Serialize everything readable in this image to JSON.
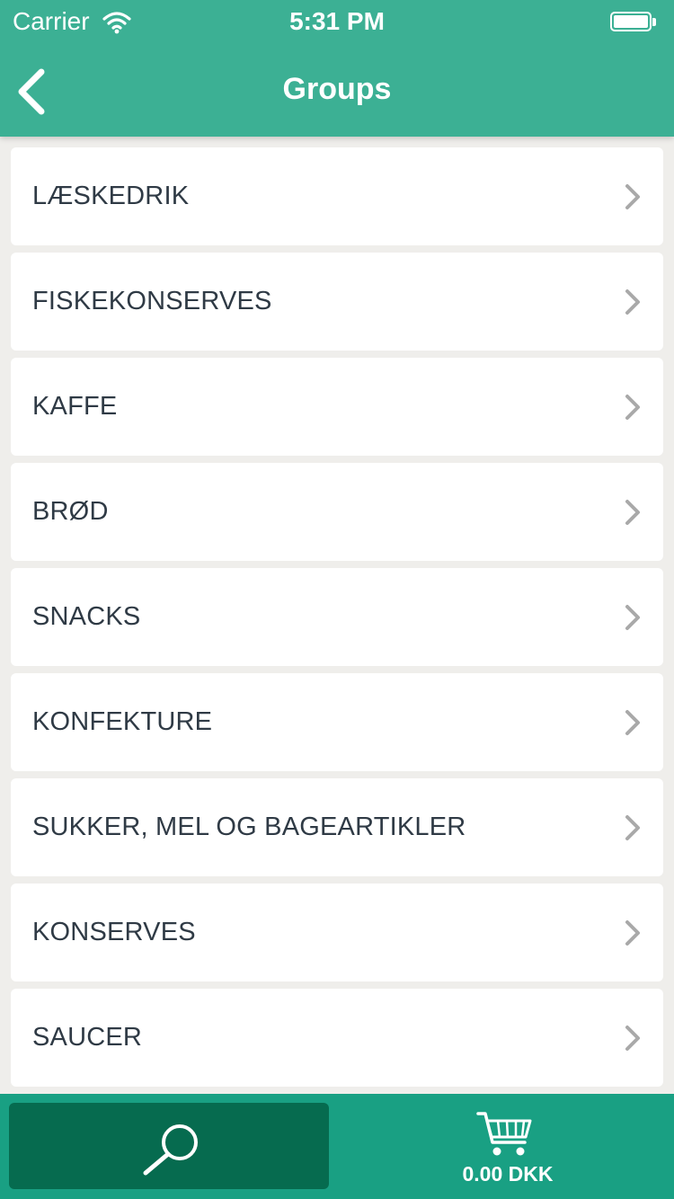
{
  "status_bar": {
    "carrier": "Carrier",
    "time": "5:31 PM"
  },
  "nav": {
    "title": "Groups",
    "back_icon": "chevron-left-icon"
  },
  "groups": [
    {
      "label": "LÆSKEDRIK"
    },
    {
      "label": "FISKEKONSERVES"
    },
    {
      "label": "KAFFE"
    },
    {
      "label": "BRØD"
    },
    {
      "label": "SNACKS"
    },
    {
      "label": "KONFEKTURE"
    },
    {
      "label": "SUKKER, MEL OG BAGEARTIKLER"
    },
    {
      "label": "KONSERVES"
    },
    {
      "label": "SAUCER"
    }
  ],
  "tab_bar": {
    "search_icon": "search-icon",
    "cart_icon": "cart-icon",
    "cart_total": "0.00 DKK"
  },
  "colors": {
    "header": "#3cb094",
    "tab_bar": "#19a083",
    "tab_active": "#066b4f",
    "background": "#efeeeb",
    "text": "#2f3a45",
    "chevron": "#a9a9a9"
  }
}
